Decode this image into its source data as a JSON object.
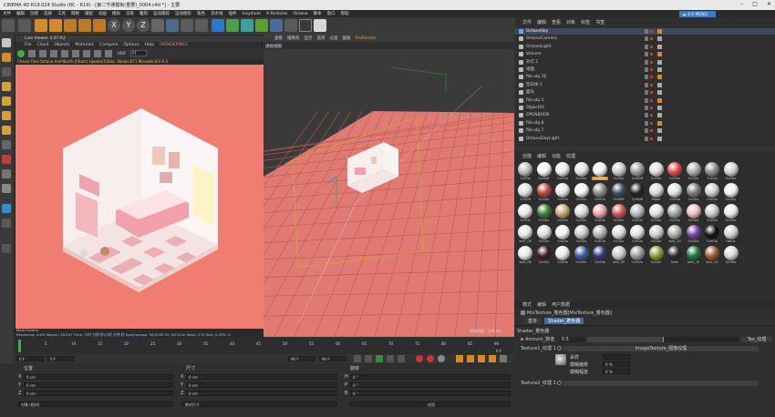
{
  "titlebar": {
    "title": "CINEMA 4D R19.024 Studio (RC - R19) - [第二节课模板(重要)_0004.c4d *] - 主要"
  },
  "menubar": {
    "items": [
      "文件",
      "编辑",
      "创建",
      "选择",
      "工具",
      "网格",
      "捕捉",
      "动画",
      "模拟",
      "渲染",
      "雕刻",
      "运动跟踪",
      "运动图形",
      "角色",
      "流水线",
      "插件",
      "Insydium",
      "X-Particles",
      "Octane",
      "脚本",
      "窗口",
      "帮助"
    ]
  },
  "cloud_badge": {
    "label": "4.0 MENU"
  },
  "toolbar": {
    "xyz": [
      "X",
      "Y",
      "Z"
    ]
  },
  "live_viewer": {
    "title": "Live Viewer 3.07-R2",
    "menu": [
      "File",
      "Cloud",
      "Objects",
      "Materials",
      "Compare",
      "Options",
      "Help",
      "[RENDERING]"
    ],
    "hdr_label": "HDR",
    "status": "Check/ Files Octane AmPlEarth /[Stats] Update[0]Disc. Nodes:871 Movable:0/3 6.0",
    "render_mode": "PT",
    "footer_tag": "Main:Octane",
    "footer": "Rendering: 4.6%    Ms/sec: 28.547   Time: 小时 分钟 秒/小时 分钟 秒   Spp/maxspp: 96/2000   Tri: 0/2.02m Mesh: 275 Hair: 0   GPU: 0"
  },
  "viewport": {
    "menu": [
      "查看",
      "摄像机",
      "显示",
      "选项",
      "过滤",
      "面板",
      "ProRender"
    ],
    "label": "透视视图",
    "footer": "网格间距 : 100 cm"
  },
  "timeline": {
    "ticks": [
      "0",
      "5",
      "10",
      "15",
      "20",
      "25",
      "30",
      "35",
      "40",
      "45",
      "50",
      "55",
      "60",
      "65",
      "70",
      "75",
      "80",
      "85",
      "90"
    ],
    "frame": "0 F"
  },
  "transport": {
    "start": "0 F",
    "current": "0 F",
    "end": "90 F",
    "end2": "90 F"
  },
  "coords": {
    "headers": [
      "位置",
      "尺寸",
      "旋转"
    ],
    "rows": [
      {
        "axis": "X",
        "pos": "0 cm",
        "size": "0 cm",
        "rot_axis": "H",
        "rot": "0 °"
      },
      {
        "axis": "Y",
        "pos": "0 cm",
        "size": "0 cm",
        "rot_axis": "P",
        "rot": "0 °"
      },
      {
        "axis": "Z",
        "pos": "0 cm",
        "size": "0 cm",
        "rot_axis": "B",
        "rot": "0 °"
      }
    ],
    "mode": "对象 (相对)",
    "size_mode": "绝对尺寸",
    "apply": "应用"
  },
  "objects": {
    "tabs": [
      "文件",
      "编辑",
      "查看",
      "对象",
      "标签",
      "书签"
    ],
    "rows": [
      {
        "name": "OctaneSky",
        "color": "#6aa6e0",
        "selected": true
      },
      {
        "name": "OctaneCamera",
        "color": "#bbbbbb",
        "selected": false
      },
      {
        "name": "OctaneLight",
        "color": "#bbbbbb",
        "selected": false
      },
      {
        "name": "Volume",
        "color": "#bbbbbb",
        "selected": false
      },
      {
        "name": "外灯.1",
        "color": "#bbbbbb",
        "selected": false
      },
      {
        "name": "地面",
        "color": "#bbbbbb",
        "selected": false
      },
      {
        "name": "file.obj.16",
        "color": "#bbbbbb",
        "selected": false
      },
      {
        "name": "空白体.1",
        "color": "#bbbbbb",
        "selected": false
      },
      {
        "name": "面光",
        "color": "#bbbbbb",
        "selected": false
      },
      {
        "name": "file.obj.5",
        "color": "#bbbbbb",
        "selected": false
      },
      {
        "name": "Object01",
        "color": "#bbbbbb",
        "selected": false
      },
      {
        "name": "OPENBOOK",
        "color": "#bbbbbb",
        "selected": false
      },
      {
        "name": "file.obj.8",
        "color": "#bbbbbb",
        "selected": false
      },
      {
        "name": "file.obj.7",
        "color": "#bbbbbb",
        "selected": false
      },
      {
        "name": "OctaneDayLight",
        "color": "#bbbbbb",
        "selected": false
      }
    ]
  },
  "materials": {
    "tabs": [
      "创建",
      "编辑",
      "功能",
      "纹理"
    ],
    "items": [
      {
        "label": "OctGlo",
        "color": "#b8b8b8"
      },
      {
        "label": "OctDiff",
        "color": "#f5f5f5"
      },
      {
        "label": "OctGlo",
        "color": "#e8e8e8"
      },
      {
        "label": "OctGlo",
        "color": "#dddddd"
      },
      {
        "label": "OctDiffu",
        "color": "#f0f0f0"
      },
      {
        "label": "OctGlo",
        "color": "#c8c8c8"
      },
      {
        "label": "OctDiff",
        "color": "#9a9a9a"
      },
      {
        "label": "OctGlo",
        "color": "#dcdcdc"
      },
      {
        "label": "OctGlo",
        "color": "#e04848"
      },
      {
        "label": "OctGlo",
        "color": "#aaaaaa"
      },
      {
        "label": "OctGlo",
        "color": "#8a8a8a"
      },
      {
        "label": "OctGlo",
        "color": "#cfcfcf"
      },
      {
        "label": "OctDiff",
        "color": "#e0e0e0"
      },
      {
        "label": "OctGlo",
        "color": "#c04040"
      },
      {
        "label": "OctGlo",
        "color": "#e6e6e6"
      },
      {
        "label": "OctGlo",
        "color": "#f2f2f2"
      },
      {
        "label": "OctGlo",
        "color": "#888888"
      },
      {
        "label": "OctDiff",
        "color": "#3a4a60"
      },
      {
        "label": "OctDiff",
        "color": "#222222"
      },
      {
        "label": "Paper",
        "color": "#d8d8d8"
      },
      {
        "label": "OctGlo",
        "color": "#e0e0e0"
      },
      {
        "label": "OctGlo",
        "color": "#7a7a7a"
      },
      {
        "label": "OctGlo",
        "color": "#cccccc"
      },
      {
        "label": "OctGlo",
        "color": "#efefef"
      },
      {
        "label": "OctGlo",
        "color": "#e8e8e8"
      },
      {
        "label": "OctGlo",
        "color": "#3a7a3a"
      },
      {
        "label": "OctGlo",
        "color": "#c7a070"
      },
      {
        "label": "OctGlo",
        "color": "#d8d8d8"
      },
      {
        "label": "OctGlo",
        "color": "#e8a0a8"
      },
      {
        "label": "OctGlo",
        "color": "#d05050"
      },
      {
        "label": "OctGlo",
        "color": "#b8b8b8"
      },
      {
        "label": "OctGlo",
        "color": "#e0e0e0"
      },
      {
        "label": "OctGlo",
        "color": "#a0a0a0"
      },
      {
        "label": "OctGlo",
        "color": "#f0b8c0"
      },
      {
        "label": "OctGlo",
        "color": "#c8c8c8"
      },
      {
        "label": "OctGlo",
        "color": "#e8e8e8"
      },
      {
        "label": "wire_08",
        "color": "#e6e6e6"
      },
      {
        "label": "OctGlo",
        "color": "#dddddd"
      },
      {
        "label": "OctGlo",
        "color": "#f0f0f0"
      },
      {
        "label": "OctGlo",
        "color": "#c8c8c8"
      },
      {
        "label": "OctGlo",
        "color": "#b0b0b0"
      },
      {
        "label": "OctGlo",
        "color": "#d8d8d8"
      },
      {
        "label": "OctGlo",
        "color": "#e0e0e0"
      },
      {
        "label": "OctGlo",
        "color": "#cccccc"
      },
      {
        "label": "wire_10",
        "color": "#aaaaaa"
      },
      {
        "label": "OctGlo",
        "color": "#7040a0"
      },
      {
        "label": "OctGlo",
        "color": "#101010"
      },
      {
        "label": "Fabric",
        "color": "#d0d0d0"
      },
      {
        "label": "wire_06",
        "color": "#e8e8e8"
      },
      {
        "label": "OctGlo",
        "color": "#3a1a1a"
      },
      {
        "label": "OctGlo",
        "color": "#e8e8e8"
      },
      {
        "label": "OctGlo",
        "color": "#3a5aa0"
      },
      {
        "label": "OctGlo",
        "color": "#2a3a70"
      },
      {
        "label": "wire_09",
        "color": "#c8c8c8"
      },
      {
        "label": "OctGlo",
        "color": "#9a9a9a"
      },
      {
        "label": "OctGlo",
        "color": "#909a30"
      },
      {
        "label": "Dark",
        "color": "#2a2a2a"
      },
      {
        "label": "wire_10",
        "color": "#1a7a3a"
      },
      {
        "label": "wire_02",
        "color": "#a05a30"
      },
      {
        "label": "OctGlo",
        "color": "#d8d8d8"
      }
    ]
  },
  "attributes": {
    "tabs": [
      "模式",
      "编辑",
      "用户数据"
    ],
    "title": "MixTexture_着色器[MixTexture_着色器]",
    "sub_tabs": [
      "基本",
      "Shader_着色器"
    ],
    "section": "Shader_着色器",
    "amount_label": "Amount_数值",
    "amount_value": "0.5",
    "amount_fraction": 0.5,
    "texture1_label": "Texture1_纹理 1",
    "texture1_value": "ImageTexture_图像纹理",
    "texture2_label": "Texture2_纹理 2",
    "tex_button": "Tex_纹理",
    "sub_fields": [
      {
        "label": "采样",
        "value": ""
      },
      {
        "label": "模糊偏移",
        "value": "0 %"
      },
      {
        "label": "模糊程度",
        "value": "0 %"
      }
    ]
  }
}
